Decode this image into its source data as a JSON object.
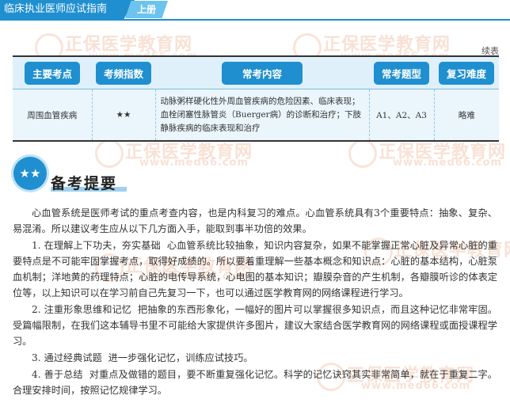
{
  "header": {
    "title": "临床执业医师应试指南",
    "volume": "上册"
  },
  "watermark": {
    "brand": "正保医学教育网",
    "url": "www.med66.com"
  },
  "table": {
    "continued_label": "续表",
    "headers": [
      "主要考点",
      "考频指数",
      "常考内容",
      "常考题型",
      "复习难度"
    ],
    "rows": [
      {
        "topic": "周围血管疾病",
        "frequency": "★★",
        "content": "动脉粥样硬化性外周血管疾病的危险因素、临床表现；血栓闭塞性脉管炎（Buerger病）的诊断和治疗；下肢静脉疾病的临床表现和治疗",
        "question_types": "A1、A2、A3",
        "difficulty": "略难"
      }
    ]
  },
  "section": {
    "icon_glyph": "★★",
    "title": "备考提要"
  },
  "paragraphs": [
    {
      "lead": "",
      "text": "心血管系统是医师考试的重点考查内容，也是内科复习的难点。心血管系统具有3个重要特点：抽象、复杂、易混淆。所以建议考生应从以下几方面入手，能取到事半功倍的效果。"
    },
    {
      "lead": "1. 在理解上下功夫，夯实基础",
      "text": "心血管系统比较抽象，知识内容复杂，如果不能掌握正常心脏及异常心脏的重要特点是不可能牢固掌握考点，取得好成绩的。所以要着重理解一些基本概念和知识点：心脏的基本结构，心脏泵血机制；洋地黄的药理特点；心脏的电传导系统，心电图的基本知识；瓣膜杂音的产生机制，各瓣膜听诊的体表定位等，以上知识可以在学习前自己先复习一下，也可以通过医学教育网的网络课程进行学习。"
    },
    {
      "lead": "2. 注重形象思维和记忆",
      "text": "把抽象的东西形象化，一幅好的图片可以掌握很多知识点，而且这种记忆非常牢固。受篇幅限制，在我们这本辅导书里不可能给大家提供许多图片，建议大家结合医学教育网的网络课程或面授课程学习。"
    },
    {
      "lead": "3. 通过经典试题",
      "text": "进一步强化记忆，训练应试技巧。"
    },
    {
      "lead": "4. 善于总结",
      "text": "对重点及做错的题目，要不断重复强化记忆。科学的记忆诀窍其实非常简单，就在于重复二字。合理安排时间，按照记忆规律学习。"
    }
  ]
}
